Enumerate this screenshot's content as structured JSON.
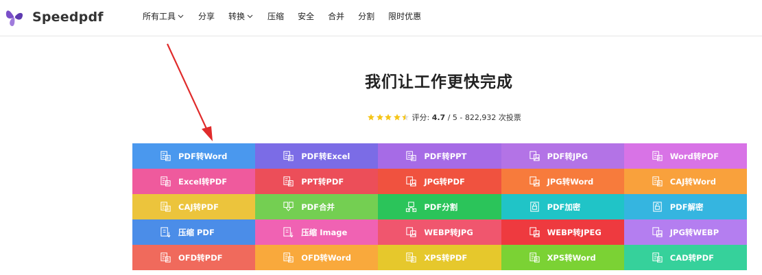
{
  "brand": {
    "name": "Speedpdf"
  },
  "nav": [
    {
      "label": "所有工具",
      "dropdown": true
    },
    {
      "label": "分享",
      "dropdown": false
    },
    {
      "label": "转换",
      "dropdown": true
    },
    {
      "label": "压缩",
      "dropdown": false
    },
    {
      "label": "安全",
      "dropdown": false
    },
    {
      "label": "合并",
      "dropdown": false
    },
    {
      "label": "分割",
      "dropdown": false
    },
    {
      "label": "限时优惠",
      "dropdown": false
    }
  ],
  "hero": {
    "title": "我们让工作更快完成"
  },
  "rating": {
    "prefix": "评分:",
    "score": "4.7",
    "suffix": "/ 5 - 822,932 次投票",
    "stars_filled": 4.5,
    "star_color": "#f5c518"
  },
  "tools": [
    {
      "label": "PDF转Word",
      "color": "#4a98ee",
      "icon": "document-convert-icon"
    },
    {
      "label": "PDF转Excel",
      "color": "#7b6ce6",
      "icon": "document-convert-icon"
    },
    {
      "label": "PDF转PPT",
      "color": "#a66be6",
      "icon": "document-convert-icon"
    },
    {
      "label": "PDF转JPG",
      "color": "#b373e6",
      "icon": "image-convert-icon"
    },
    {
      "label": "Word转PDF",
      "color": "#d873e6",
      "icon": "document-convert-icon"
    },
    {
      "label": "Excel转PDF",
      "color": "#ef5a9d",
      "icon": "document-convert-icon"
    },
    {
      "label": "PPT转PDF",
      "color": "#ec4e59",
      "icon": "document-convert-icon"
    },
    {
      "label": "JPG转PDF",
      "color": "#f0523f",
      "icon": "image-convert-icon"
    },
    {
      "label": "JPG转Word",
      "color": "#f77b3c",
      "icon": "image-convert-icon"
    },
    {
      "label": "CAJ转Word",
      "color": "#f9a13c",
      "icon": "document-convert-icon"
    },
    {
      "label": "CAJ转PDF",
      "color": "#ecc43c",
      "icon": "document-convert-icon"
    },
    {
      "label": "PDF合并",
      "color": "#74cf52",
      "icon": "merge-icon"
    },
    {
      "label": "PDF分割",
      "color": "#2bc45a",
      "icon": "split-icon"
    },
    {
      "label": "PDF加密",
      "color": "#20c4c7",
      "icon": "lock-icon"
    },
    {
      "label": "PDF解密",
      "color": "#35b5e0",
      "icon": "unlock-icon"
    },
    {
      "label": "压缩 PDF",
      "color": "#4b8de8",
      "icon": "compress-icon"
    },
    {
      "label": "压缩 Image",
      "color": "#f062b3",
      "icon": "compress-icon"
    },
    {
      "label": "WEBP转JPG",
      "color": "#f0566e",
      "icon": "image-convert-icon"
    },
    {
      "label": "WEBP转JPEG",
      "color": "#ee3a3f",
      "icon": "image-convert-icon"
    },
    {
      "label": "JPG转WEBP",
      "color": "#b47ef0",
      "icon": "image-convert-icon"
    },
    {
      "label": "OFD转PDF",
      "color": "#f06a5c",
      "icon": "document-convert-icon"
    },
    {
      "label": "OFD转Word",
      "color": "#f9a93c",
      "icon": "document-convert-icon"
    },
    {
      "label": "XPS转PDF",
      "color": "#e6c82c",
      "icon": "document-convert-icon"
    },
    {
      "label": "XPS转Word",
      "color": "#7bd234",
      "icon": "document-convert-icon"
    },
    {
      "label": "CAD转PDF",
      "color": "#36d19b",
      "icon": "document-convert-icon"
    }
  ]
}
